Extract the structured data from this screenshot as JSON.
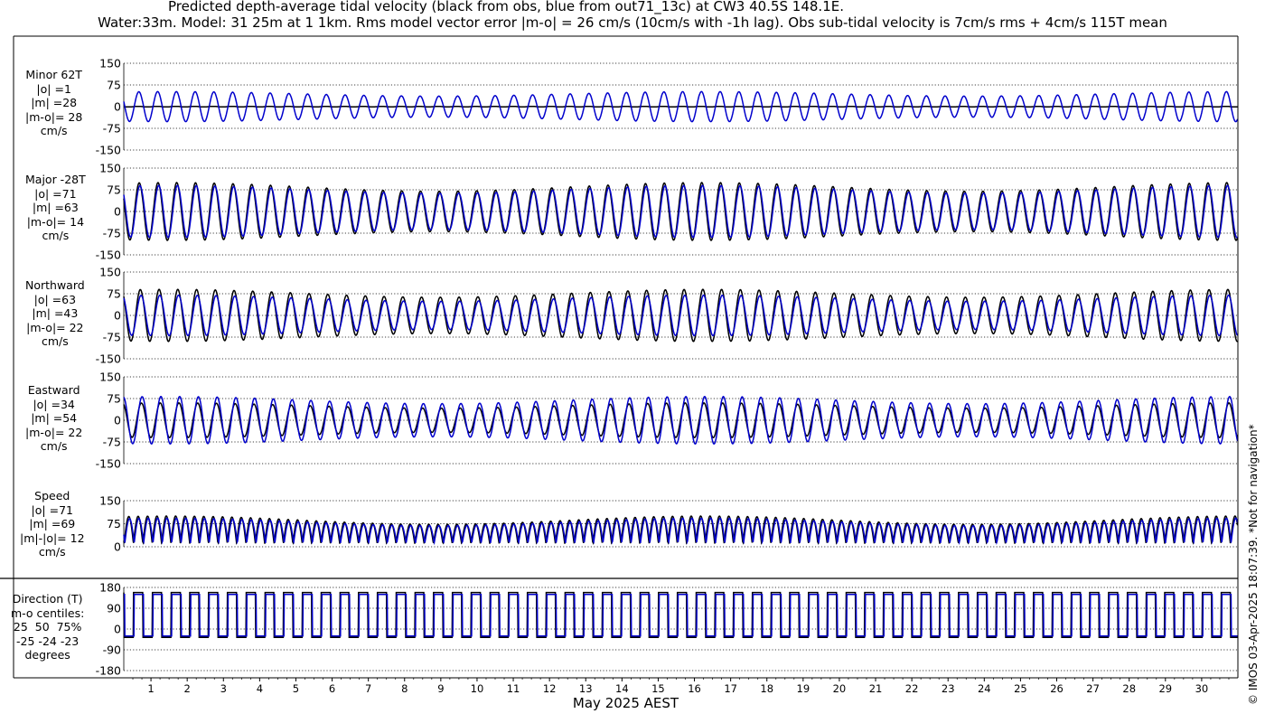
{
  "header": {
    "title": "Predicted depth-average tidal velocity (black from obs, blue from out71_13c) at CW3 40.5S 148.1E.",
    "subtitle": "Water:33m. Model: 31 25m at 1 1km. Rms model vector error |m-o| = 26 cm/s (10cm/s with -1h lag). Obs sub-tidal velocity is 7cm/s rms + 4cm/s 115T mean"
  },
  "credit": "© IMOS 03-Apr-2025 18:07:39. *Not for navigation*",
  "colors": {
    "obs": "#000000",
    "model": "#0000cc",
    "grid": "#000000",
    "frame": "#000000"
  },
  "chart_data": {
    "type": "line",
    "xlabel": "May 2025 AEST",
    "x_ticks": [
      "1",
      "2",
      "3",
      "4",
      "5",
      "6",
      "7",
      "8",
      "9",
      "10",
      "11",
      "12",
      "13",
      "14",
      "15",
      "16",
      "17",
      "18",
      "19",
      "20",
      "21",
      "22",
      "23",
      "24",
      "25",
      "26",
      "27",
      "28",
      "29",
      "30"
    ],
    "xlim": [
      0.25,
      31.0
    ],
    "series_legend": {
      "obs": "black from obs",
      "model": "blue from out71_13c"
    },
    "panels": [
      {
        "id": "minor",
        "label_lines": [
          "Minor 62T",
          "|o| =1",
          "|m| =28",
          "|m-o|= 28",
          "cm/s"
        ],
        "ylim": [
          -150,
          150
        ],
        "yticks": [
          "150",
          "75",
          "0",
          "-75",
          "-150"
        ],
        "ytick_values": [
          150,
          75,
          0,
          -75,
          -150
        ],
        "obs_amplitude": 1,
        "model_amplitude": 52
      },
      {
        "id": "major",
        "label_lines": [
          "Major -28T",
          "|o| =71",
          "|m| =63",
          "|m-o|= 14",
          "cm/s"
        ],
        "ylim": [
          -150,
          150
        ],
        "yticks": [
          "150",
          "75",
          "0",
          "-75",
          "-150"
        ],
        "ytick_values": [
          150,
          75,
          0,
          -75,
          -150
        ],
        "obs_amplitude": 100,
        "model_amplitude": 90
      },
      {
        "id": "north",
        "label_lines": [
          "Northward",
          "|o| =63",
          "|m| =43",
          "|m-o|= 22",
          "cm/s"
        ],
        "ylim": [
          -150,
          150
        ],
        "yticks": [
          "150",
          "75",
          "0",
          "-75",
          "-150"
        ],
        "ytick_values": [
          150,
          75,
          0,
          -75,
          -150
        ],
        "obs_amplitude": 90,
        "model_amplitude": 70
      },
      {
        "id": "east",
        "label_lines": [
          "Eastward",
          "|o| =34",
          "|m| =54",
          "|m-o|= 22",
          "cm/s"
        ],
        "ylim": [
          -150,
          150
        ],
        "yticks": [
          "150",
          "75",
          "0",
          "-75",
          "-150"
        ],
        "ytick_values": [
          150,
          75,
          0,
          -75,
          -150
        ],
        "obs_amplitude": 60,
        "model_amplitude": 82
      },
      {
        "id": "speed",
        "label_lines": [
          "Speed",
          "|o| =71",
          "|m| =69",
          "|m|-|o|= 12",
          "cm/s"
        ],
        "ylim": [
          0,
          150
        ],
        "yticks": [
          "150",
          "75",
          "0"
        ],
        "ytick_values": [
          150,
          75,
          0
        ],
        "obs_amplitude": 100,
        "model_amplitude": 90
      },
      {
        "id": "direction",
        "label_lines": [
          "Direction (T)",
          "m-o centiles:",
          "25  50  75%",
          "-25 -24 -23",
          "degrees"
        ],
        "ylim": [
          -180,
          180
        ],
        "yticks": [
          "180",
          "90",
          "0",
          "-90",
          "-180"
        ],
        "ytick_values": [
          180,
          90,
          0,
          -90,
          -180
        ],
        "high_deg": 150,
        "low_deg": -30
      }
    ]
  }
}
